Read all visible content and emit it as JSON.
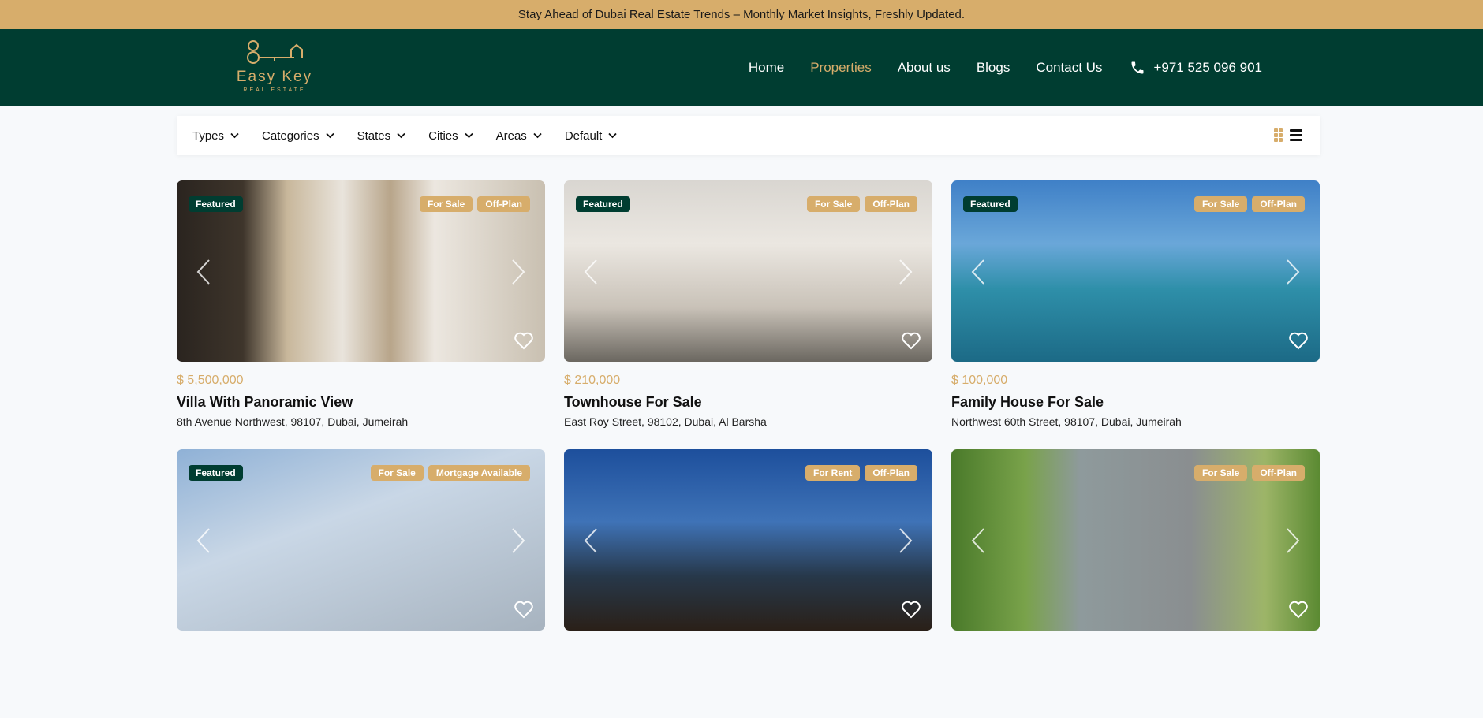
{
  "promo": {
    "text": "Stay Ahead of Dubai Real Estate Trends – Monthly Market Insights, Freshly Updated."
  },
  "logo": {
    "name": "Easy Key",
    "sub": "REAL ESTATE"
  },
  "nav": {
    "items": [
      "Home",
      "Properties",
      "About us",
      "Blogs",
      "Contact Us"
    ],
    "active": "Properties",
    "phone": "+971 525 096 901"
  },
  "filters": [
    "Types",
    "Categories",
    "States",
    "Cities",
    "Areas",
    "Default"
  ],
  "colors": {
    "brand_green": "#003d31",
    "gold": "#d7ad6b"
  },
  "cards": [
    {
      "featured": "Featured",
      "tags": [
        "For Sale",
        "Off-Plan"
      ],
      "price": "$ 5,500,000",
      "title": "Villa With Panoramic View",
      "address": "8th Avenue Northwest, 98107, Dubai, Jumeirah"
    },
    {
      "featured": "Featured",
      "tags": [
        "For Sale",
        "Off-Plan"
      ],
      "price": "$ 210,000",
      "title": "Townhouse For Sale",
      "address": "East Roy Street, 98102, Dubai, Al Barsha"
    },
    {
      "featured": "Featured",
      "tags": [
        "For Sale",
        "Off-Plan"
      ],
      "price": "$ 100,000",
      "title": "Family House For Sale",
      "address": "Northwest 60th Street, 98107, Dubai, Jumeirah"
    },
    {
      "featured": "Featured",
      "tags": [
        "For Sale",
        "Mortgage Available"
      ],
      "price": "",
      "title": "",
      "address": ""
    },
    {
      "featured": "",
      "tags": [
        "For Rent",
        "Off-Plan"
      ],
      "price": "",
      "title": "",
      "address": ""
    },
    {
      "featured": "",
      "tags": [
        "For Sale",
        "Off-Plan"
      ],
      "price": "",
      "title": "",
      "address": ""
    }
  ]
}
